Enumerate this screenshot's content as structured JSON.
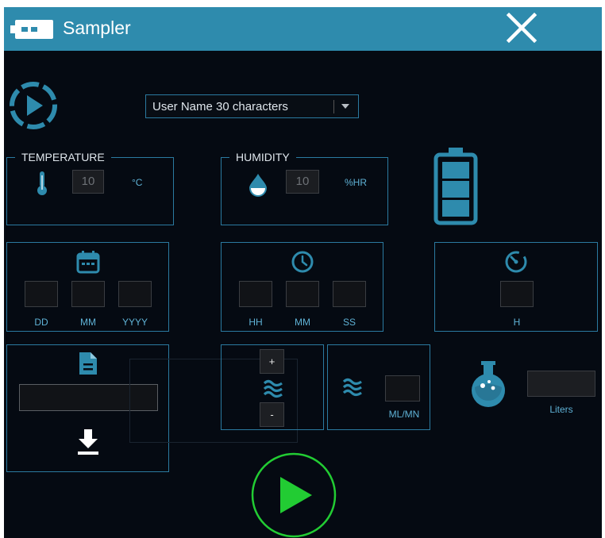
{
  "window": {
    "title": "Sampler",
    "close_icon": "close-icon",
    "app_icon": "battery-horizontal-icon"
  },
  "user_select": {
    "value": "User Name 30 characters"
  },
  "temperature": {
    "legend": "TEMPERATURE",
    "value": "10",
    "unit": "°C",
    "icon": "thermometer-icon"
  },
  "humidity": {
    "legend": "HUMIDITY",
    "value": "10",
    "unit": "%HR",
    "icon": "droplet-icon"
  },
  "battery": {
    "icon": "battery-vertical-icon",
    "level_bars": 3
  },
  "date": {
    "icon": "calendar-icon",
    "labels": [
      "DD",
      "MM",
      "YYYY"
    ]
  },
  "time": {
    "icon": "clock-icon",
    "labels": [
      "HH",
      "MM",
      "SS"
    ]
  },
  "duration": {
    "icon": "timer-icon",
    "label": "H"
  },
  "file": {
    "icon": "file-icon",
    "download_icon": "download-icon"
  },
  "flow": {
    "plus": "+",
    "minus": "-",
    "unit": "ML/MN",
    "icon": "flow-waves-icon"
  },
  "volume": {
    "icon": "flask-icon",
    "unit": "Liters"
  },
  "colors": {
    "accent": "#2e8bad",
    "border": "#2b7aa0",
    "play": "#22cc33",
    "background": "#050a12"
  }
}
